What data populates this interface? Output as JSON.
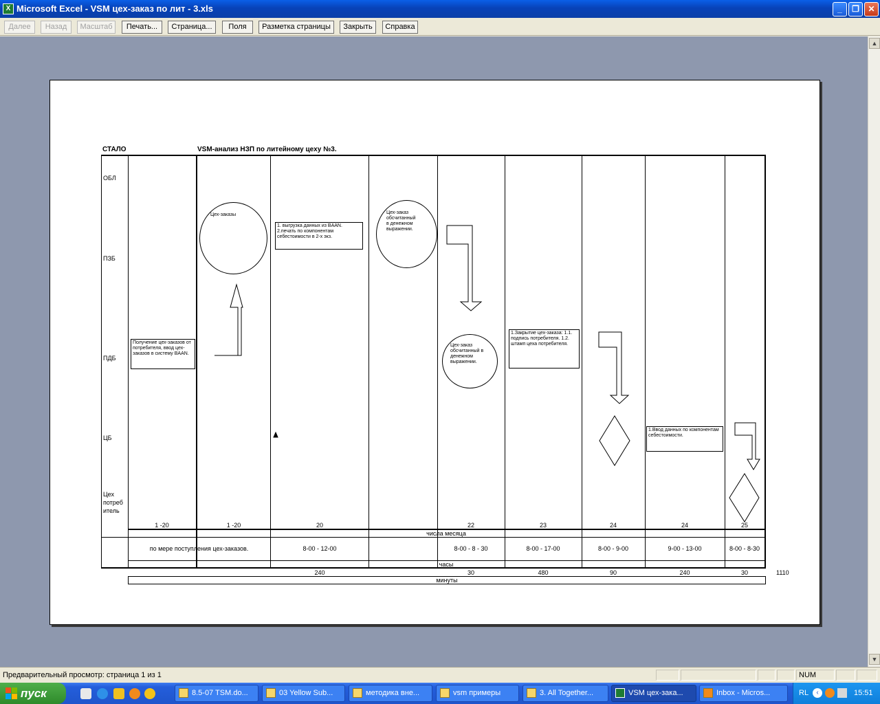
{
  "window": {
    "title": "Microsoft Excel - VSM  цех-заказ по лит - 3.xls",
    "app_icon": "excel-icon",
    "controls": {
      "minimize": "_",
      "maximize": "❐",
      "close": "✕"
    }
  },
  "toolbar": {
    "next": "Далее",
    "previous": "Назад",
    "zoom": "Масштаб",
    "print": "Печать...",
    "setup": "Страница...",
    "margins": "Поля",
    "page_break": "Разметка страницы",
    "close": "Закрыть",
    "help": "Справка"
  },
  "sheet": {
    "left_header": "СТАЛО",
    "title": "VSM-анализ  НЗП  по литейному цеху №3.",
    "rows": {
      "obl": "ОБЛ",
      "pzb": "ПЗБ",
      "pdb": "ПДБ",
      "cb": "ЦБ",
      "consumer": "Цех потреб итель"
    },
    "boxes": {
      "receive": "Получение цех-заказов от потребителя, ввод цех-заказов в систему BAAN.",
      "unload": "1. выгрузка данных из BAAN. 2.печать по компонентам себестоимости в 2-х экз.",
      "closing": "1.Закрытие цех-заказа: 1.1. подпись потребителя. 1.2. штамп цеха потребителя.",
      "input": "1.Ввод данных по компонентам себестоимости."
    },
    "circles": {
      "orders": "Цех-заказы",
      "valued1": "Цех-заказ обсчитанный в денежном выражении.",
      "valued2": "Цех-заказ обсчитанный в денежном выражении."
    },
    "dates": [
      "1 -20",
      "1 -20",
      "20",
      "22",
      "23",
      "24",
      "24",
      "25"
    ],
    "dates_label": "числа месяца",
    "hours": [
      "по мере поступления цех-заказов.",
      "8-00 - 12-00",
      "8-00 - 8 - 30",
      "8-00 - 17-00",
      "8-00 - 9-00",
      "9-00 - 13-00",
      "8-00   -  8-30"
    ],
    "hours_label": "часы",
    "minutes": [
      "240",
      "30",
      "480",
      "90",
      "240",
      "30"
    ],
    "minutes_total": "1110",
    "minutes_label": "минуты"
  },
  "status": {
    "text": "Предварительный просмотр: страница 1 из 1",
    "num": "NUM"
  },
  "taskbar": {
    "start": "пуск",
    "tasks": [
      "8.5-07 TSM.do...",
      "03 Yellow Sub...",
      "методика вне...",
      "vsm примеры",
      "3. All Together...",
      "VSM  цех-зака...",
      "Inbox - Micros..."
    ],
    "lang": "RL",
    "clock": "15:51"
  }
}
